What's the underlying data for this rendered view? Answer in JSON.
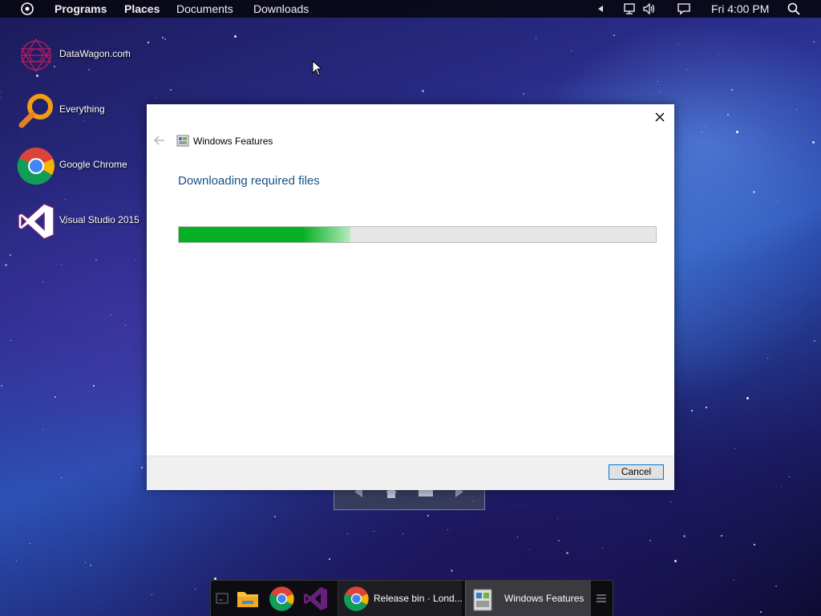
{
  "topbar": {
    "menu": [
      "Programs",
      "Places",
      "Documents",
      "Downloads"
    ],
    "clock": "Fri 4:00 PM"
  },
  "desktop_icons": [
    {
      "label": "DataWagon.com"
    },
    {
      "label": "Everything"
    },
    {
      "label": "Google Chrome"
    },
    {
      "label": "Visual Studio 2015"
    }
  ],
  "dialog": {
    "title": "Windows Features",
    "heading": "Downloading required files",
    "progress": 0.36,
    "cancel_label": "Cancel",
    "accent": "#06b025"
  },
  "taskbar": {
    "chrome_window": "Release bin · Lond...",
    "features_window": "Windows Features"
  }
}
